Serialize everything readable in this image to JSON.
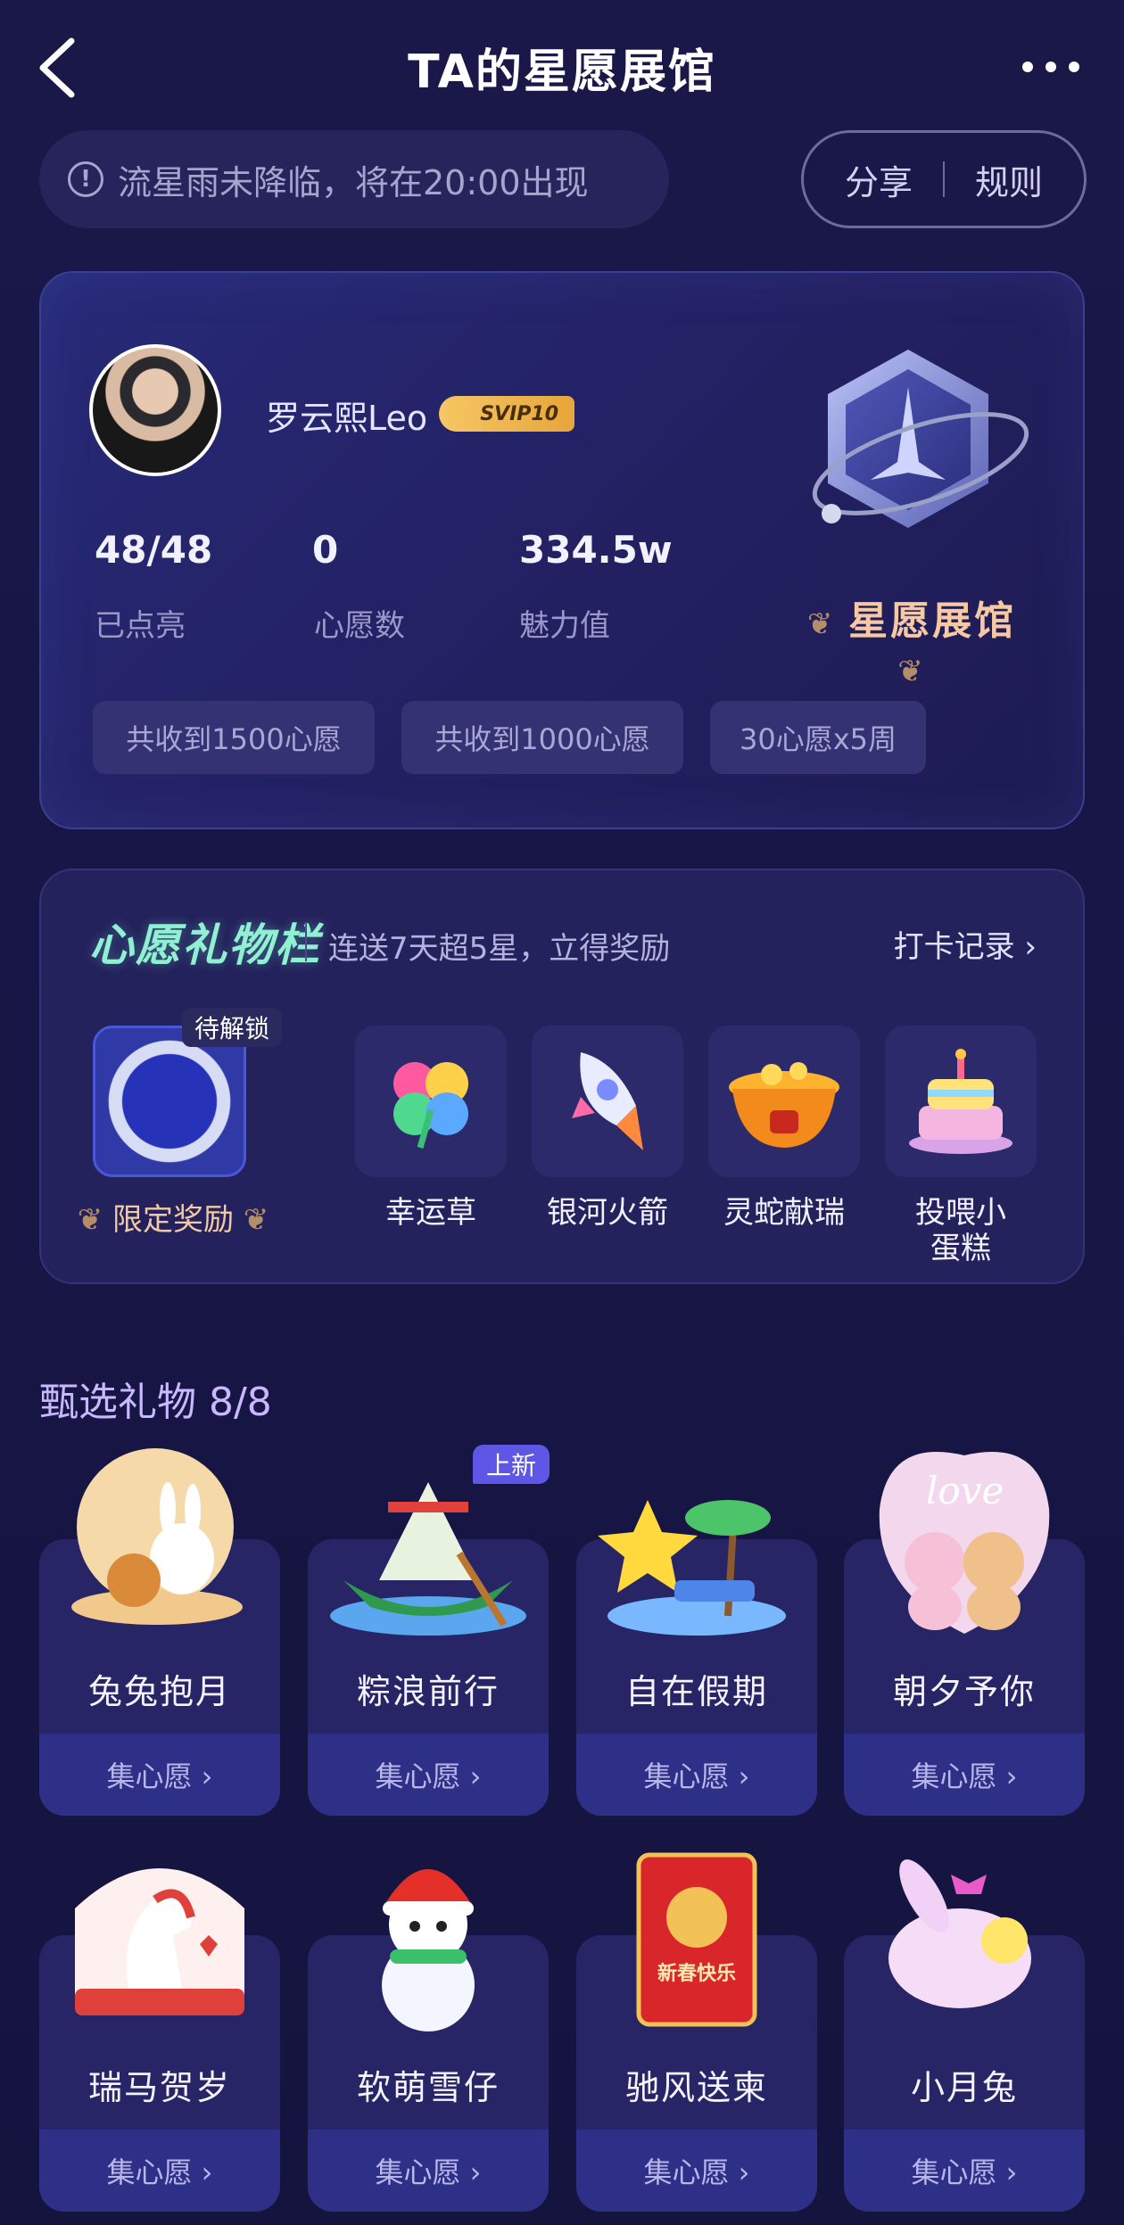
{
  "header": {
    "title": "TA的星愿展馆"
  },
  "notice": {
    "text": "流星雨未降临，将在20:00出现"
  },
  "actions": {
    "share": "分享",
    "rules": "规则"
  },
  "profile": {
    "username": "罗云熙Leo",
    "vip": "SVIP10",
    "stats": [
      {
        "value": "48/48",
        "label": "已点亮"
      },
      {
        "value": "0",
        "label": "心愿数"
      },
      {
        "value": "334.5w",
        "label": "魅力值"
      }
    ],
    "hall_title": "星愿展馆",
    "tags": [
      "共收到1500心愿",
      "共收到1000心愿",
      "30心愿x5周"
    ]
  },
  "gift_bar": {
    "title": "心愿礼物栏",
    "subtitle": "连送7天超5星，立得奖励",
    "record_link": "打卡记录 ›",
    "unlock_tag": "待解锁",
    "limited_label": "限定奖励",
    "gifts": [
      {
        "name": "幸运草",
        "icon": "clover-icon"
      },
      {
        "name": "银河火箭",
        "icon": "rocket-icon"
      },
      {
        "name": "灵蛇献瑞",
        "icon": "treasure-pot-icon"
      },
      {
        "name": "投喂小蛋糕",
        "icon": "cake-icon"
      }
    ]
  },
  "selected": {
    "title": "甄选礼物 8/8",
    "new_badge": "上新",
    "collect_label": "集心愿 ›",
    "items": [
      {
        "name": "兔兔抱月"
      },
      {
        "name": "粽浪前行"
      },
      {
        "name": "自在假期"
      },
      {
        "name": "朝夕予你"
      },
      {
        "name": "瑞马贺岁"
      },
      {
        "name": "软萌雪仔"
      },
      {
        "name": "驰风送柬"
      },
      {
        "name": "小月兔"
      }
    ],
    "art_texts": {
      "love": "love",
      "new_year": "新春快乐"
    }
  },
  "colors": {
    "accent_mint": "#8ff0d2",
    "hall_gold": "#f7c9a3",
    "bg": "#1a1848"
  }
}
